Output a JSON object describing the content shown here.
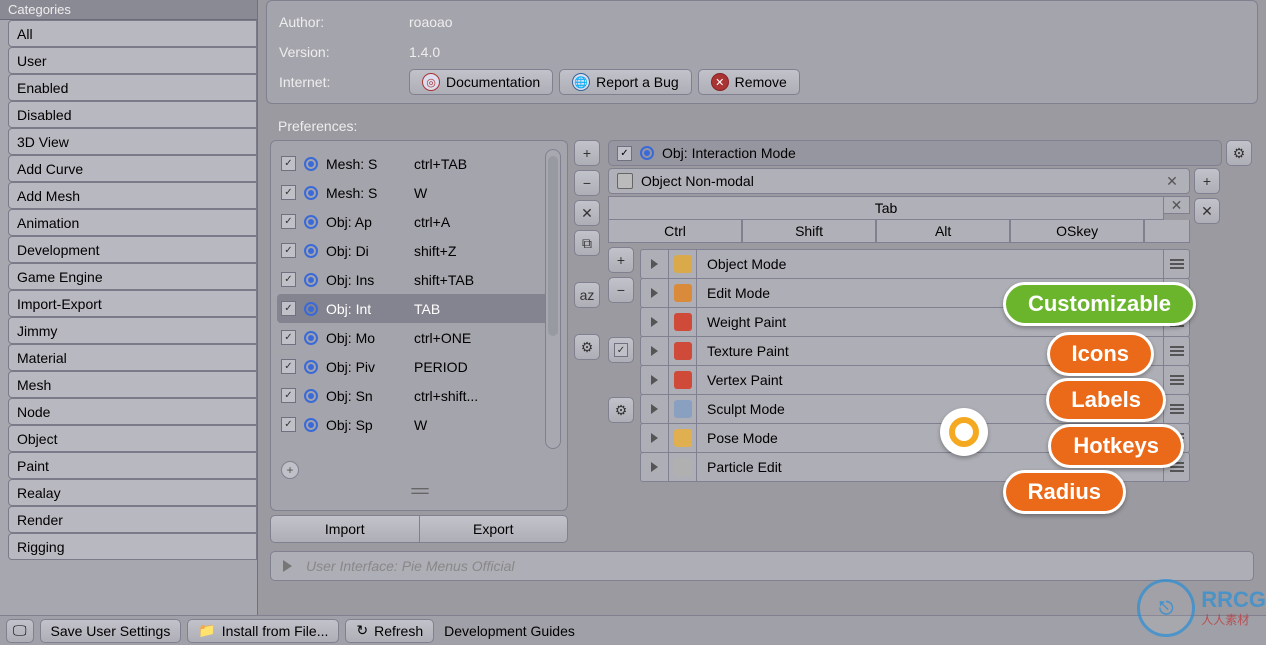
{
  "sidebar": {
    "header": "Categories",
    "items": [
      "All",
      "User",
      "Enabled",
      "Disabled",
      "3D View",
      "Add Curve",
      "Add Mesh",
      "Animation",
      "Development",
      "Game Engine",
      "Import-Export",
      "Jimmy",
      "Material",
      "Mesh",
      "Node",
      "Object",
      "Paint",
      "Realay",
      "Render",
      "Rigging"
    ]
  },
  "info": {
    "author_label": "Author:",
    "author_value": "roaoao",
    "version_label": "Version:",
    "version_value": "1.4.0",
    "internet_label": "Internet:",
    "doc_btn": "Documentation",
    "bug_btn": "Report a Bug",
    "remove_btn": "Remove"
  },
  "prefs_label": "Preferences:",
  "list_items": [
    {
      "name": "Mesh: S",
      "key": "ctrl+TAB",
      "active": false
    },
    {
      "name": "Mesh: S",
      "key": "W",
      "active": false
    },
    {
      "name": "Obj: Ap",
      "key": "ctrl+A",
      "active": false
    },
    {
      "name": "Obj: Di",
      "key": "shift+Z",
      "active": false
    },
    {
      "name": "Obj: Ins",
      "key": "shift+TAB",
      "active": false
    },
    {
      "name": "Obj: Int",
      "key": "TAB",
      "active": true
    },
    {
      "name": "Obj: Mo",
      "key": "ctrl+ONE",
      "active": false
    },
    {
      "name": "Obj: Piv",
      "key": "PERIOD",
      "active": false
    },
    {
      "name": "Obj: Sn",
      "key": "ctrl+shift...",
      "active": false
    },
    {
      "name": "Obj: Sp",
      "key": "W",
      "active": false
    }
  ],
  "import_label": "Import",
  "export_label": "Export",
  "mid_btns": [
    "+",
    "−",
    "✕",
    "⧉",
    "",
    "aᴢ",
    "",
    "⚙"
  ],
  "right_side_btns": [
    "⧉",
    "✕"
  ],
  "mode_header": "Obj: Interaction Mode",
  "sub_header": "Object Non-modal",
  "tab_label": "Tab",
  "mods": [
    "Ctrl",
    "Shift",
    "Alt",
    "OSkey"
  ],
  "modes": [
    {
      "label": "Object Mode",
      "color": "#d9a94a"
    },
    {
      "label": "Edit Mode",
      "color": "#d98a3a"
    },
    {
      "label": "Weight Paint",
      "color": "#d04a3a"
    },
    {
      "label": "Texture Paint",
      "color": "#d04a3a"
    },
    {
      "label": "Vertex Paint",
      "color": "#d04a3a"
    },
    {
      "label": "Sculpt Mode",
      "color": "#8aa0c0"
    },
    {
      "label": "Pose Mode",
      "color": "#e0b050"
    },
    {
      "label": "Particle Edit",
      "color": "#b0b0b0"
    }
  ],
  "rc_mid": [
    "+",
    "−",
    "",
    "✓",
    "",
    "⚙"
  ],
  "expand_label": "User Interface: Pie Menus Official",
  "bottombar": {
    "save": "Save User Settings",
    "install": "Install from File...",
    "refresh": "Refresh",
    "guides": "Development Guides"
  },
  "annotations": {
    "customizable": "Customizable",
    "icons": "Icons",
    "labels": "Labels",
    "hotkeys": "Hotkeys",
    "radius": "Radius"
  },
  "watermark": {
    "main": "RRCG",
    "sub": "人人素材"
  }
}
